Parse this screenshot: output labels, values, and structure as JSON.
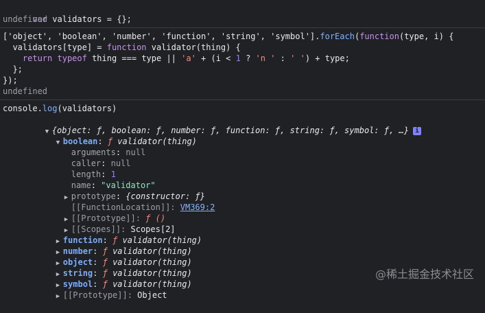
{
  "entries": {
    "e1": {
      "code": "var validators = {};",
      "result": "undefined"
    },
    "e2": {
      "line1_a": "['object', 'boolean', 'number', 'function', 'string', 'symbol'].",
      "line1_b": "forEach",
      "line1_c": "(",
      "line1_d": "function",
      "line1_e": "(type, i) {",
      "line2_a": "  validators[type] = ",
      "line2_b": "function",
      "line2_c": " validator(thing) {",
      "line3_a": "    ",
      "line3_b": "return",
      "line3_c": " ",
      "line3_d": "typeof",
      "line3_e": " thing === type || ",
      "line3_f": "'a'",
      "line3_g": " + (i < ",
      "line3_h": "1",
      "line3_i": " ? ",
      "line3_j": "'n '",
      "line3_k": " : ",
      "line3_l": "' '",
      "line3_m": ") + type;",
      "line4": "  };",
      "line5": "});",
      "result": "undefined"
    },
    "e3": {
      "code_a": "console.",
      "code_b": "log",
      "code_c": "(validators)"
    }
  },
  "output": {
    "summary": "{object: ƒ, boolean: ƒ, number: ƒ, function: ƒ, string: ƒ, symbol: ƒ, …}",
    "info_badge": "i",
    "boolean": {
      "key": "boolean",
      "fsym": "ƒ",
      "sig": "validator(thing)",
      "props": {
        "arguments": {
          "k": "arguments",
          "v": "null"
        },
        "caller": {
          "k": "caller",
          "v": "null"
        },
        "length": {
          "k": "length",
          "v": "1"
        },
        "name": {
          "k": "name",
          "v": "\"validator\""
        },
        "prototype": {
          "k": "prototype",
          "v": "{constructor: ƒ}"
        },
        "fnloc": {
          "k": "[[FunctionLocation]]",
          "v": "VM369:2"
        },
        "proto": {
          "k": "[[Prototype]]",
          "v": "ƒ ()"
        },
        "scopes": {
          "k": "[[Scopes]]",
          "v": "Scopes[2]"
        }
      }
    },
    "rows": {
      "function": {
        "key": "function",
        "fsym": "ƒ",
        "sig": "validator(thing)"
      },
      "number": {
        "key": "number",
        "fsym": "ƒ",
        "sig": "validator(thing)"
      },
      "object": {
        "key": "object",
        "fsym": "ƒ",
        "sig": "validator(thing)"
      },
      "string": {
        "key": "string",
        "fsym": "ƒ",
        "sig": "validator(thing)"
      },
      "symbol": {
        "key": "symbol",
        "fsym": "ƒ",
        "sig": "validator(thing)"
      },
      "proto": {
        "key": "[[Prototype]]",
        "value": "Object"
      }
    }
  },
  "watermark": "@稀土掘金技术社区"
}
